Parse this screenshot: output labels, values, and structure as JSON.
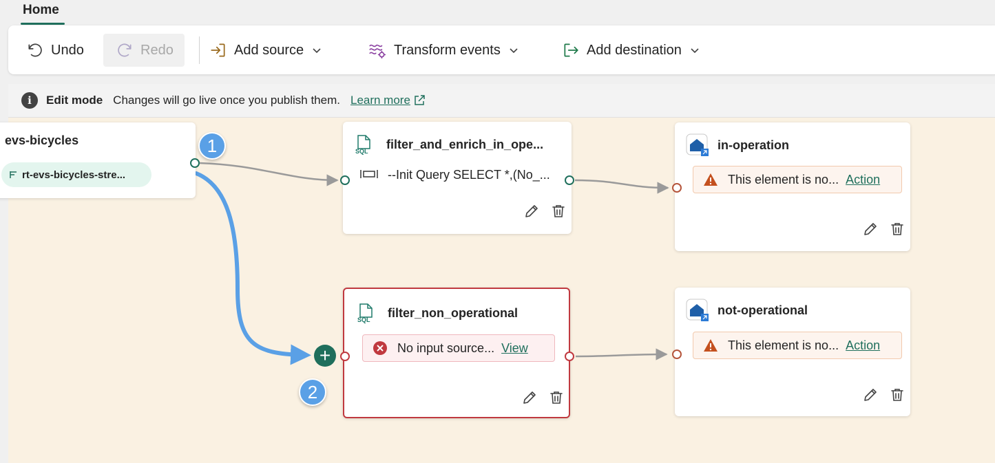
{
  "tabs": {
    "home": "Home"
  },
  "toolbar": {
    "undo": "Undo",
    "redo": "Redo",
    "add_source": "Add source",
    "transform_events": "Transform events",
    "add_destination": "Add destination"
  },
  "banner": {
    "info_glyph": "i",
    "title": "Edit mode",
    "message": "Changes will go live once you publish them.",
    "link": "Learn more"
  },
  "source_node": {
    "title": "evs-bicycles",
    "stream": "rt-evs-bicycles-stre..."
  },
  "operators": [
    {
      "title": "filter_and_enrich_in_ope...",
      "detail": "--Init Query SELECT *,(No_..."
    },
    {
      "title": "filter_non_operational",
      "error": "No input source...",
      "error_action": "View"
    }
  ],
  "destinations": [
    {
      "title": "in-operation",
      "warning": "This element is no...",
      "action": "Action"
    },
    {
      "title": "not-operational",
      "warning": "This element is no...",
      "action": "Action"
    }
  ],
  "callouts": {
    "one": "1",
    "two": "2"
  },
  "colors": {
    "accent": "#1f6f5c",
    "warning": "#c4501e",
    "error": "#c0393f",
    "callout": "#5aa0e6"
  }
}
